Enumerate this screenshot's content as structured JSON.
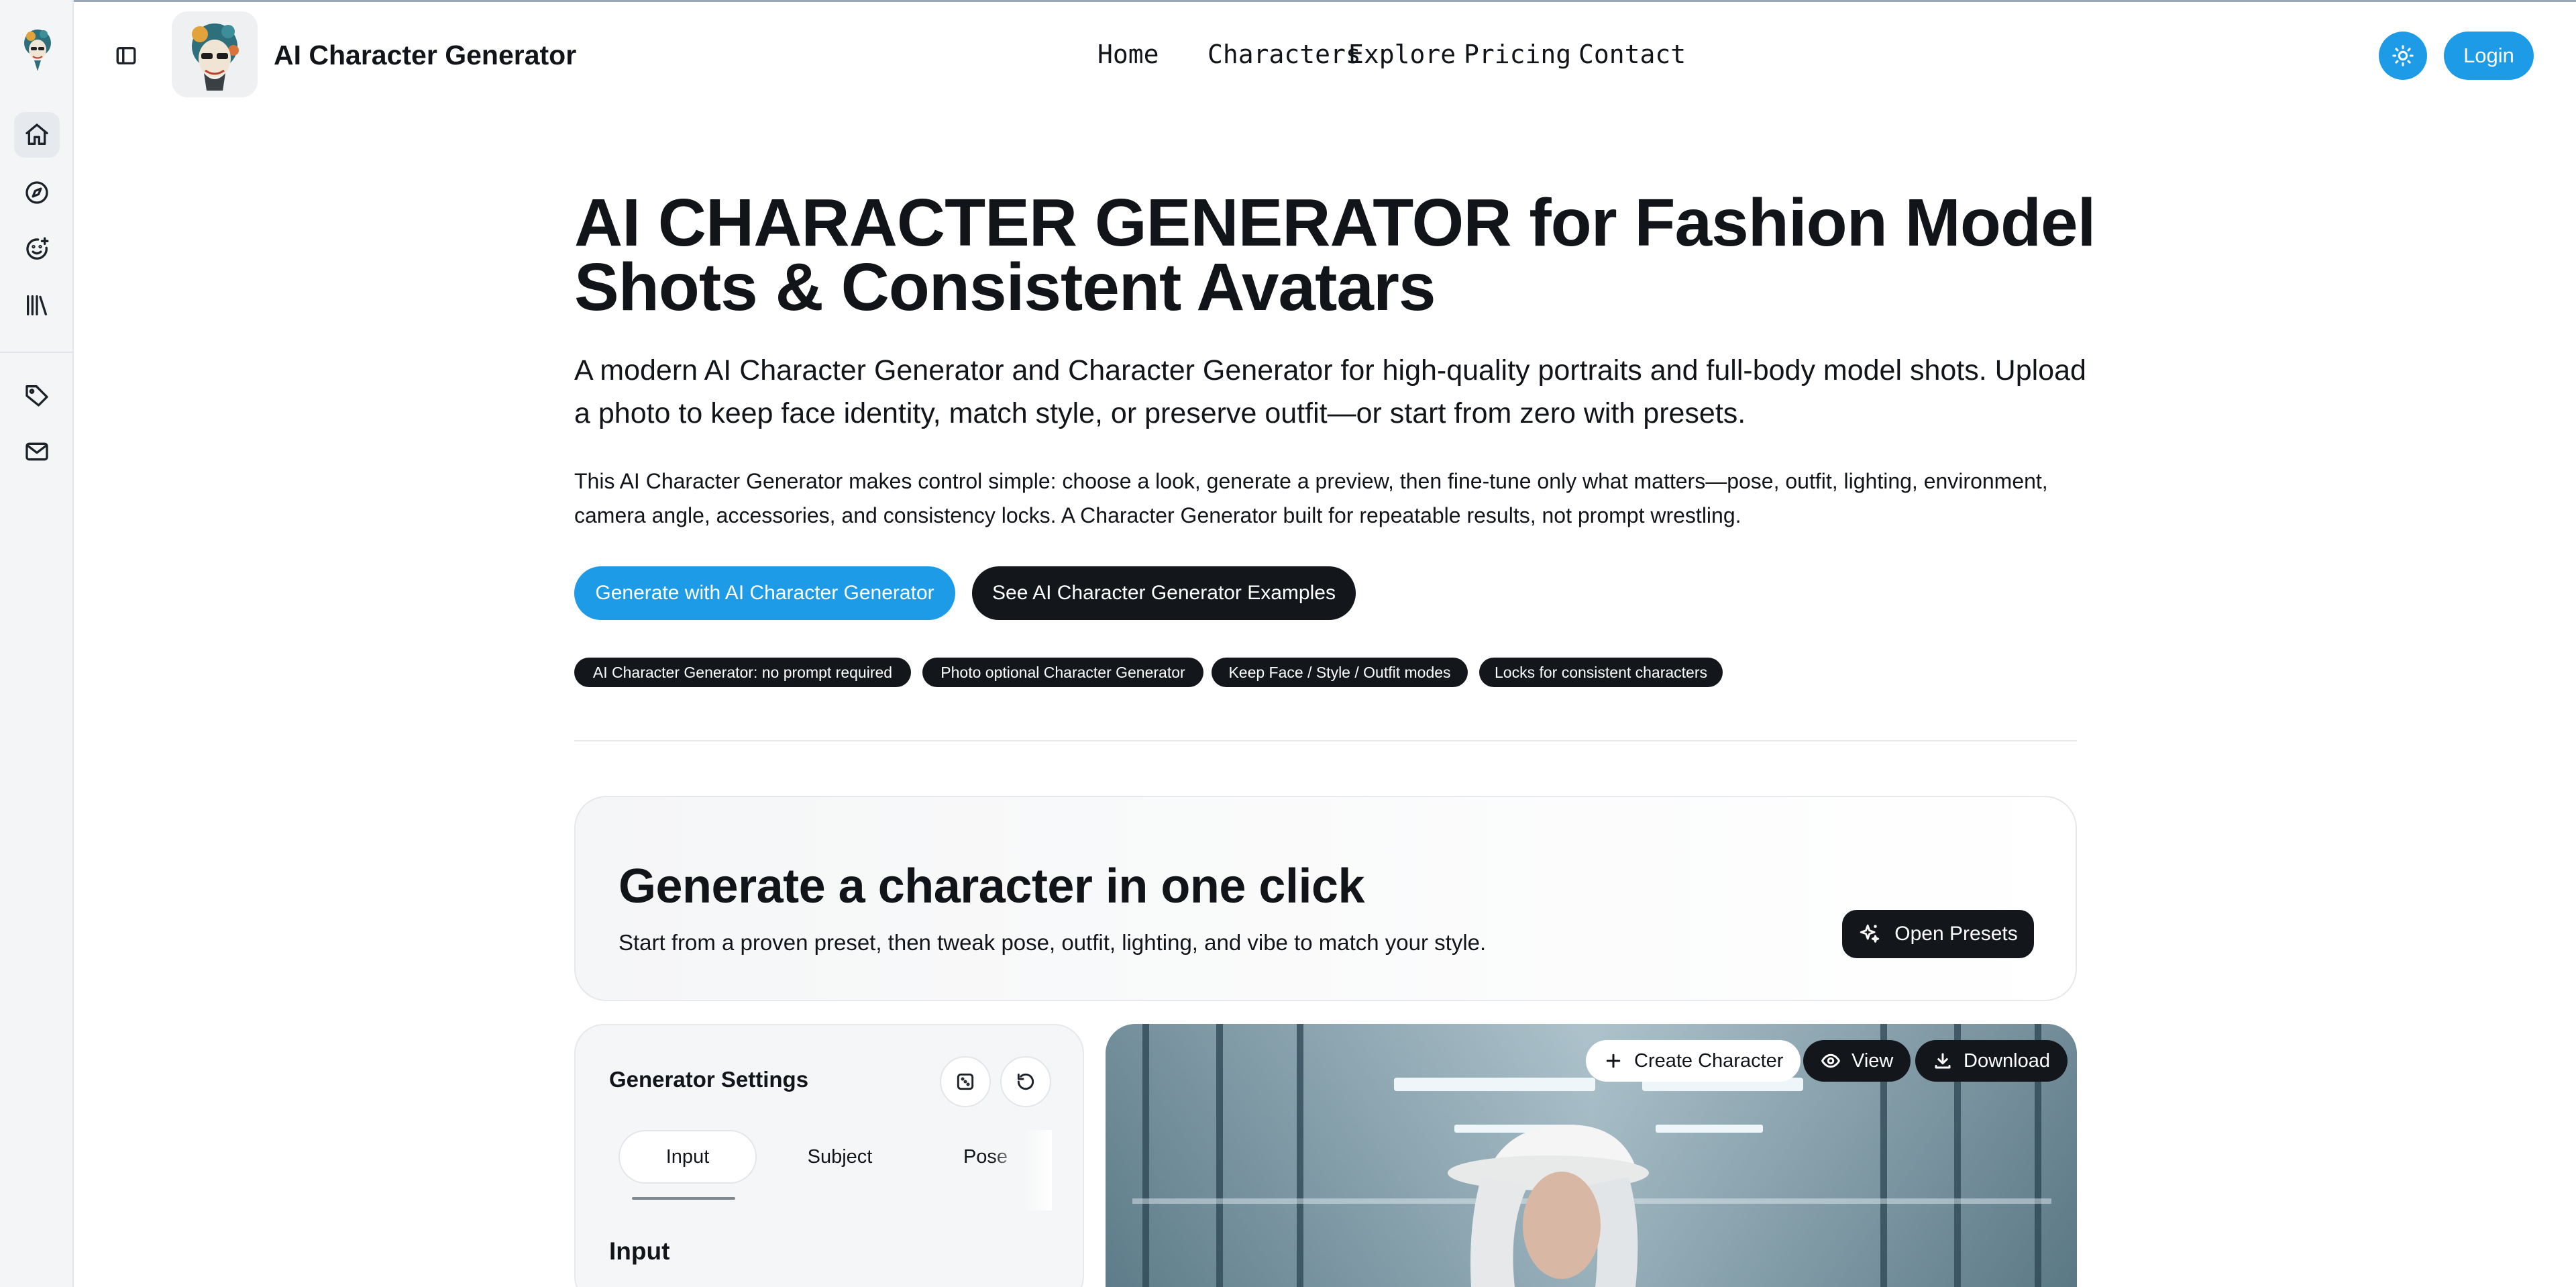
{
  "app": {
    "name": "AI Character Generator"
  },
  "nav": {
    "items": [
      "Home",
      "Characters",
      "Explore",
      "Pricing",
      "Contact"
    ],
    "login": "Login"
  },
  "rail": {
    "icons": [
      "home-icon",
      "compass-icon",
      "smiley-plus-icon",
      "library-icon",
      "tag-icon",
      "mail-icon"
    ],
    "active": "home-icon"
  },
  "hero": {
    "title": "AI CHARACTER GENERATOR for Fashion Model Shots & Consistent Avatars",
    "lead": "A modern AI Character Generator and Character Generator for high-quality portraits and full-body model shots. Upload a photo to keep face identity, match style, or preserve outfit—or start from zero with presets.",
    "body": "This AI Character Generator makes control simple: choose a look, generate a preview, then fine-tune only what matters—pose, outfit, lighting, environment, camera angle, accessories, and consistency locks. A Character Generator built for repeatable results, not prompt wrestling.",
    "primary_button": "Generate with AI Character Generator",
    "secondary_button": "See AI Character Generator Examples",
    "chips": [
      "AI Character Generator: no prompt required",
      "Photo optional Character Generator",
      "Keep Face / Style / Outfit modes",
      "Locks for consistent characters"
    ]
  },
  "one_click": {
    "title": "Generate a character in one click",
    "subtitle": "Start from a proven preset, then tweak pose, outfit, lighting, and vibe to match your style.",
    "presets_button": "Open Presets"
  },
  "settings": {
    "title": "Generator Settings",
    "tabs": [
      "Input",
      "Subject",
      "Pose"
    ],
    "active_tab": "Input",
    "section": "Input"
  },
  "preview": {
    "create": "Create Character",
    "view": "View",
    "download": "Download"
  },
  "colors": {
    "accent": "#1e9be6",
    "dark": "#13171c",
    "panel": "#f5f6f7"
  }
}
